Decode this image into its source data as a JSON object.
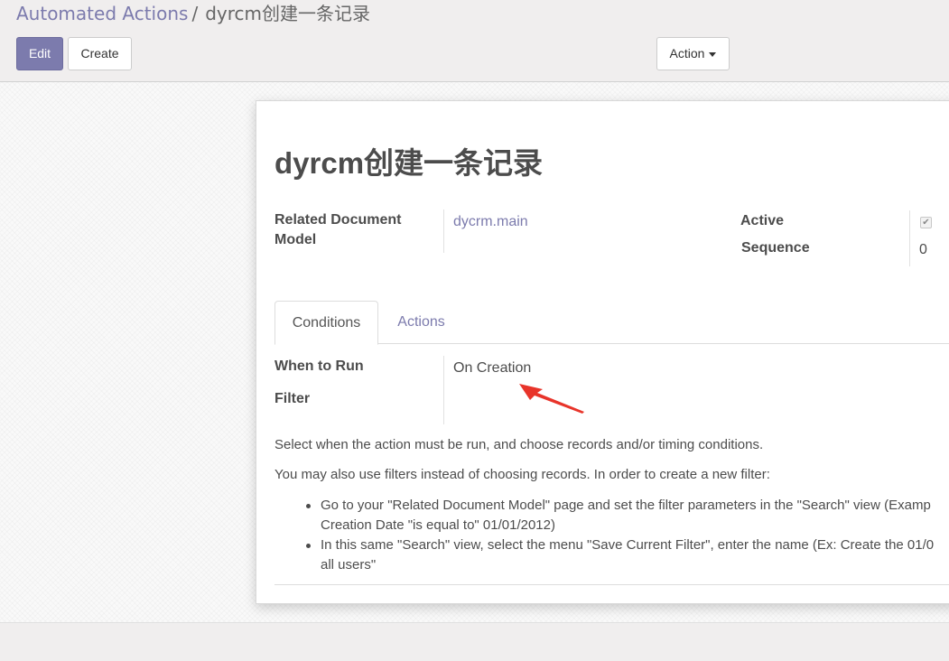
{
  "breadcrumb": {
    "parent": "Automated Actions",
    "separator": "/",
    "current": "dyrcm创建一条记录"
  },
  "toolbar": {
    "edit_label": "Edit",
    "create_label": "Create",
    "action_label": "Action"
  },
  "record": {
    "title": "dyrcm创建一条记录",
    "related_model_label_line1": "Related Document",
    "related_model_label_line2": "Model",
    "related_model_value": "dycrm.main",
    "active_label": "Active",
    "active_checked": true,
    "sequence_label": "Sequence",
    "sequence_value": "0"
  },
  "tabs": [
    {
      "label": "Conditions",
      "active": true
    },
    {
      "label": "Actions",
      "active": false
    }
  ],
  "conditions": {
    "when_to_run_label": "When to Run",
    "when_to_run_value": "On Creation",
    "filter_label": "Filter",
    "help_intro": "Select when the action must be run, and choose records and/or timing conditions.",
    "help_filters": "You may also use filters instead of choosing records. In order to create a new filter:",
    "help_items": [
      {
        "line1": "Go to your \"Related Document Model\" page and set the filter parameters in the \"Search\" view (Examp",
        "line2": "Creation Date \"is equal to\" 01/01/2012)"
      },
      {
        "line1": "In this same \"Search\" view, select the menu \"Save Current Filter\", enter the name (Ex: Create the 01/0",
        "line2": "all users\""
      }
    ]
  },
  "colors": {
    "accent": "#7c7bad",
    "annotation_arrow": "#e8342a"
  }
}
